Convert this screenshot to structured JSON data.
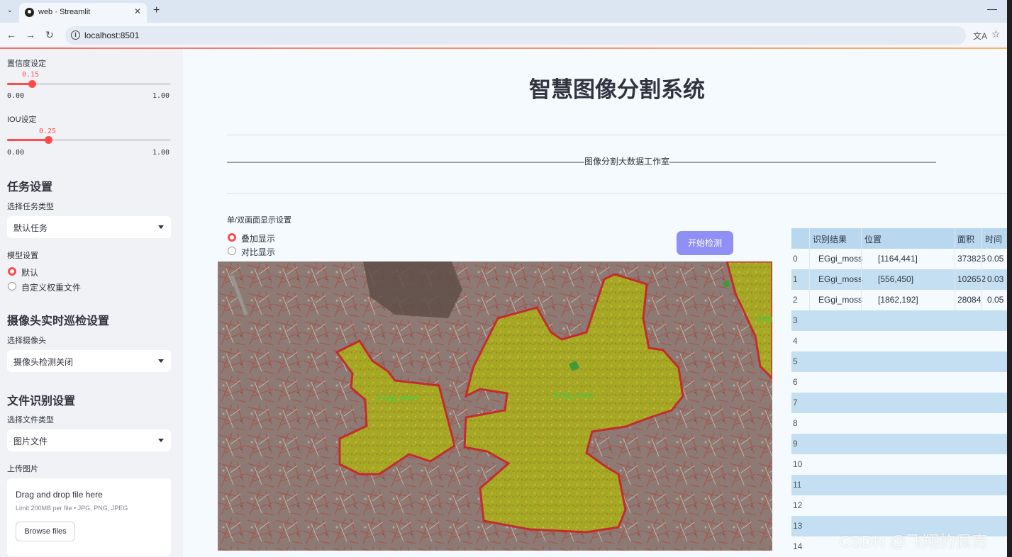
{
  "browser": {
    "tab_title": "web · Streamlit",
    "url": "localhost:8501"
  },
  "sidebar": {
    "confidence": {
      "label": "置信度设定",
      "value": "0.15",
      "min": "0.00",
      "max": "1.00",
      "fraction": 0.15
    },
    "iou": {
      "label": "IOU设定",
      "value": "0.25",
      "min": "0.00",
      "max": "1.00",
      "fraction": 0.25
    },
    "task_heading": "任务设置",
    "task_type_label": "选择任务类型",
    "task_type_value": "默认任务",
    "model_label": "模型设置",
    "model_options": [
      "默认",
      "自定义权重文件"
    ],
    "model_selected": 0,
    "camera_heading": "摄像头实时巡检设置",
    "camera_label": "选择摄像头",
    "camera_value": "摄像头检测关闭",
    "file_heading": "文件识别设置",
    "file_type_label": "选择文件类型",
    "file_type_value": "图片文件",
    "upload_label": "上传图片",
    "upload_title": "Drag and drop file here",
    "upload_limit": "Limit 200MB per file • JPG, PNG, JPEG",
    "upload_button": "Browse files"
  },
  "main": {
    "title": "智慧图像分割系统",
    "banner": "——————————————————————————————————————————图像分割大数据工作室——————————————————————————————————————————",
    "display_mode_label": "单/双画面显示设置",
    "display_options": [
      "叠加显示",
      "对比显示"
    ],
    "display_selected": 0,
    "start_button": "开始检测",
    "mask_label": "EGgi_moss"
  },
  "table": {
    "headers": [
      "识别结果",
      "位置",
      "面积",
      "时间"
    ],
    "rows": [
      {
        "index": "0",
        "result": "EGgi_moss",
        "position": "[1164,441]",
        "area": "373825",
        "time": "0.05"
      },
      {
        "index": "1",
        "result": "EGgi_moss",
        "position": "[556,450]",
        "area": "102652",
        "time": "0.03"
      },
      {
        "index": "2",
        "result": "EGgi_moss",
        "position": "[1862,192]",
        "area": "28084",
        "time": "0.05"
      }
    ],
    "empty_indices": [
      "3",
      "4",
      "5",
      "6",
      "7",
      "8",
      "9",
      "10",
      "11",
      "12",
      "13",
      "14"
    ]
  },
  "watermark": "CSDN @飞翔的佩奇",
  "colors": {
    "accent": "#ff4b4b",
    "button": "#8f8ff5",
    "mask": "#b3b81c",
    "mask_outline": "#c8262a"
  }
}
